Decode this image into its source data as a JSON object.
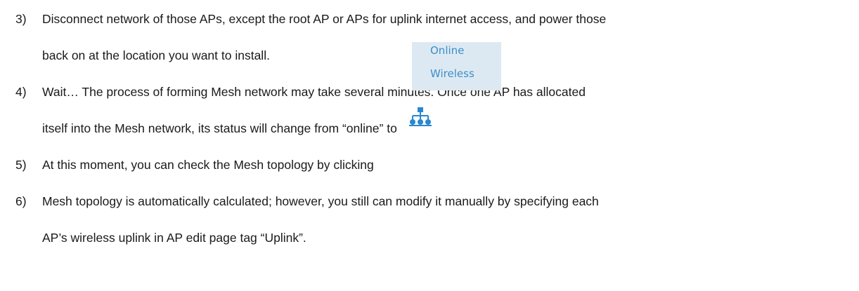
{
  "steps": [
    {
      "number": "3)",
      "lines": [
        "Disconnect network of those APs, except the root AP or APs for uplink internet access, and power those",
        "back on at the location you want to install."
      ]
    },
    {
      "number": "4)",
      "lines": [
        "Wait… The process of forming Mesh network may take several minutes. Once one AP has allocated",
        "itself into the Mesh network, its status will change from “online” to"
      ]
    },
    {
      "number": "5)",
      "lines": [
        "At this moment, you can check the Mesh topology by clicking"
      ]
    },
    {
      "number": "6)",
      "lines": [
        "Mesh topology is automatically calculated; however, you still can modify it manually by specifying each",
        "AP’s wireless uplink in AP edit page tag “Uplink”."
      ]
    }
  ],
  "status_badge": {
    "line1": "Online",
    "line2": "Wireless",
    "text_color": "#3d8ec9",
    "background": "#dde9f2"
  },
  "topology_icon": {
    "icon": "network-topology-icon",
    "color": "#2a87d0"
  }
}
